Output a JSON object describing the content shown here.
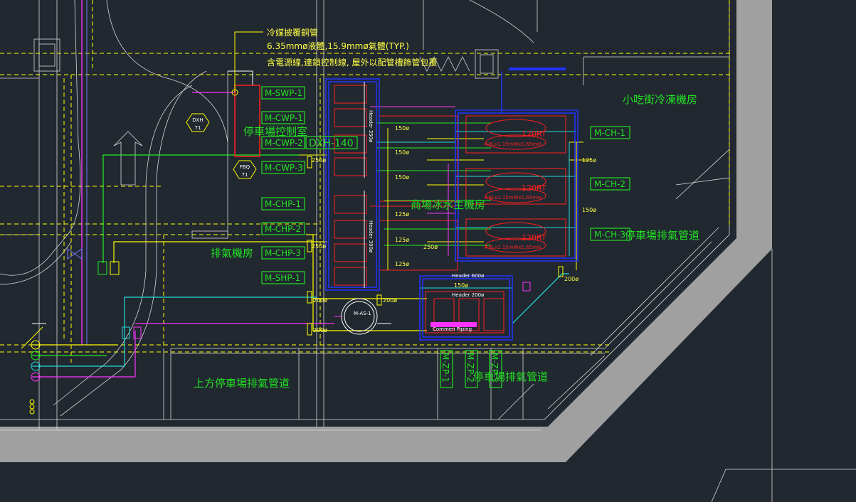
{
  "drawing": {
    "background": "#212830",
    "note_lines": [
      "冷媒披覆銅管",
      "6.35mmø液體,15.9mmø氣體(TYP.)",
      "含電源線,連鎖控制線, 屋外以配管槽飾管包覆"
    ],
    "rooms": {
      "snack_cold_room": "小吃街冷凍機房",
      "parking_control": "停車場控制室",
      "mall_plant_room": "商場冰水主機房",
      "parking_exhaust_right": "停車場排氣管道",
      "exhaust_room": "排氣機房",
      "upper_parking_exhaust": "上方停車場排氣管道",
      "parking_exhaust_bottom": "停車場排氣管道"
    },
    "equipment_tags": {
      "swp1": "M-SWP-1",
      "cwp1": "M-CWP-1",
      "cwp2": "M-CWP-2",
      "cwp3": "M-CWP-3",
      "chp1": "M-CHP-1",
      "chp2": "M-CHP-2",
      "chp3": "M-CHP-3",
      "shp1": "M-SHP-1",
      "ch1": "M-CH-1",
      "ch2": "M-CH-2",
      "ch3": "M-CH-3",
      "zp1": "M-ZP-1",
      "zp2": "M-ZP-2",
      "zp3": "M-ZP-3",
      "dxh_unit": "DXH-140"
    },
    "symbols": {
      "dxh_hex_top": "DXH",
      "dxh_hex_bottom": "71",
      "fbq_hex_top": "FBQ",
      "fbq_hex_bottom": "71",
      "as_tank": "M-AS-1"
    },
    "headers": {
      "header_350": "Header 350ø",
      "header_300": "Header 300ø",
      "header_600": "Header 600ø",
      "header_200": "Header 200ø",
      "common_piping": "Commen Piping"
    },
    "chillers": {
      "label": "120RT",
      "spec": "4.8Lx1.15mWx1.65mH"
    },
    "pipe_sizes": {
      "p150a": "150ø",
      "p150b": "150ø",
      "p150c": "150ø",
      "p125a": "125ø",
      "p125b": "125ø",
      "p125c": "125ø",
      "p125d": "125ø",
      "p150e": "150ø",
      "p200a": "200ø",
      "p200b": "200ø",
      "p200c": "200ø",
      "p200d": "200ø",
      "p250a": "250ø",
      "p250b": "250ø",
      "p250c": "250ø",
      "p150f": "150ø"
    },
    "colors": {
      "tag_green": "#22e022",
      "pipe_yellow": "#ffff00",
      "pipe_magenta": "#ff33ff",
      "pipe_cyan": "#22dddd",
      "equip_red": "#ff2020",
      "frame_blue": "#2233ff",
      "wall_grey": "#a0a0a0"
    }
  }
}
